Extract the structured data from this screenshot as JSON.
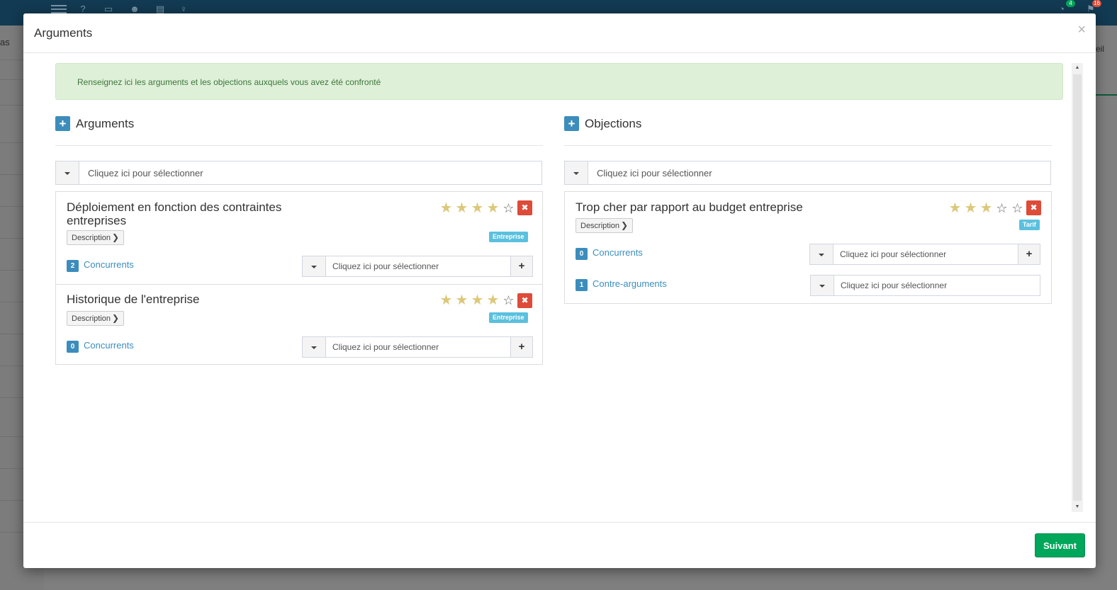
{
  "background": {
    "left_text": "as",
    "right_text": "eil",
    "notif_badge_1": "4",
    "notif_badge_2": "16"
  },
  "colors": {
    "primary": "#3c8dbc",
    "success": "#00a65a",
    "danger": "#dd4b39",
    "info": "#5bc0de",
    "star": "#dcc87a",
    "alert_bg": "#dff0d8",
    "alert_text": "#3c763d"
  },
  "modal": {
    "title": "Arguments",
    "close_label": "×",
    "info_message": "Renseignez ici les arguments et les objections auxquels vous avez été confronté",
    "next_button": "Suivant"
  },
  "arguments_section": {
    "title": "Arguments",
    "add_label": "+",
    "select_placeholder": "Cliquez ici pour sélectionner",
    "items": [
      {
        "title": "Déploiement en fonction des contraintes entreprises",
        "description_label": "Description",
        "rating": 4,
        "rating_max": 5,
        "tag": "Entreprise",
        "delete_label": "✖",
        "competitors_count": "2",
        "competitors_label": "Concurrents",
        "competitors_placeholder": "Cliquez ici pour sélectionner",
        "add_label": "+"
      },
      {
        "title": "Historique de l'entreprise",
        "description_label": "Description",
        "rating": 4,
        "rating_max": 5,
        "tag": "Entreprise",
        "delete_label": "✖",
        "competitors_count": "0",
        "competitors_label": "Concurrents",
        "competitors_placeholder": "Cliquez ici pour sélectionner",
        "add_label": "+"
      }
    ]
  },
  "objections_section": {
    "title": "Objections",
    "add_label": "+",
    "select_placeholder": "Cliquez ici pour sélectionner",
    "items": [
      {
        "title": "Trop cher par rapport au budget entreprise",
        "description_label": "Description",
        "rating": 3,
        "rating_max": 5,
        "tag": "Tarif",
        "delete_label": "✖",
        "competitors_count": "0",
        "competitors_label": "Concurrents",
        "competitors_placeholder": "Cliquez ici pour sélectionner",
        "add_label": "+",
        "counter_count": "1",
        "counter_label": "Contre-arguments",
        "counter_placeholder": "Cliquez ici pour sélectionner"
      }
    ]
  }
}
